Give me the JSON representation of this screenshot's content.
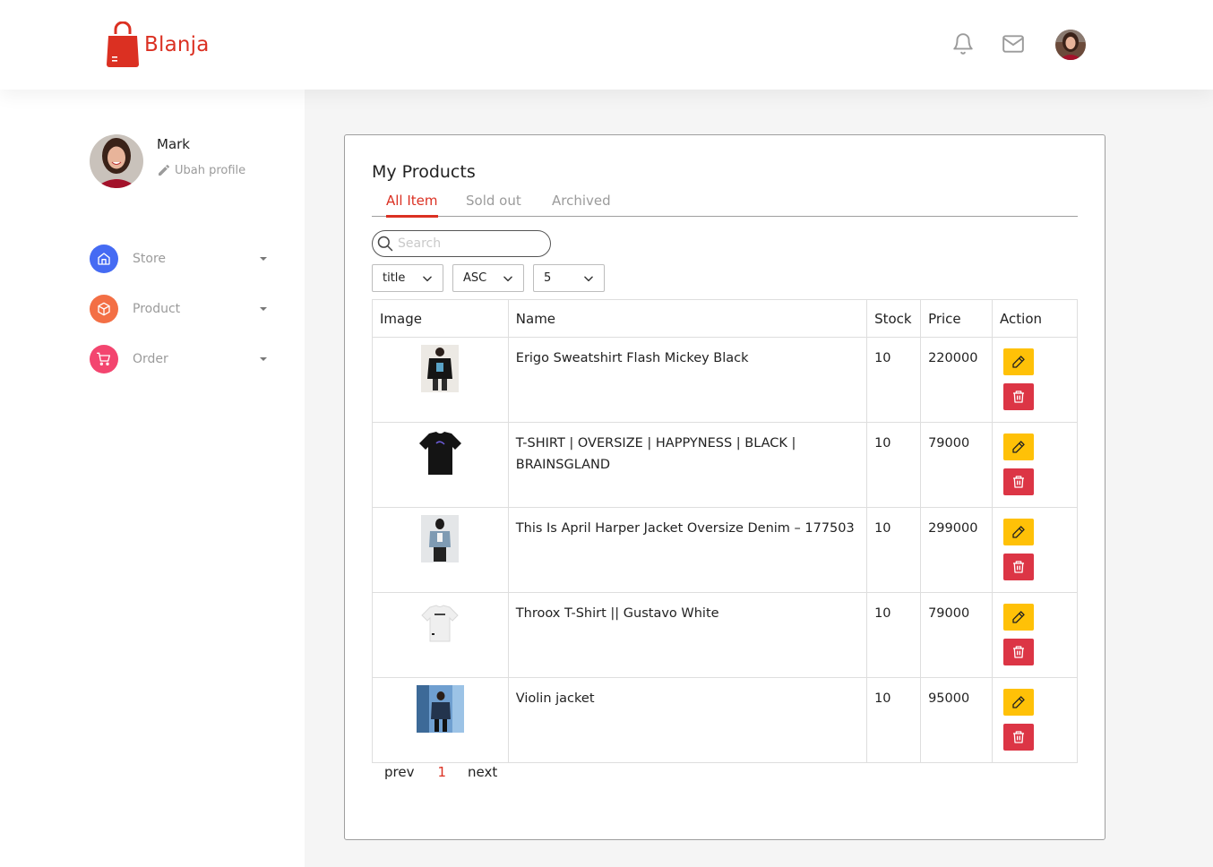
{
  "header": {
    "brand": "Blanja",
    "brand_color": "#db3022",
    "icons": [
      "bell-icon",
      "mail-icon"
    ]
  },
  "sidebar": {
    "profile_name": "Mark",
    "edit_label": "Ubah profile",
    "items": [
      {
        "label": "Store",
        "icon": "home-icon",
        "color": "#456bf3"
      },
      {
        "label": "Product",
        "icon": "package-icon",
        "color": "#f36f45"
      },
      {
        "label": "Order",
        "icon": "cart-icon",
        "color": "#f3456f"
      }
    ]
  },
  "main": {
    "title": "My Products",
    "tabs": [
      {
        "label": "All Item",
        "active": true
      },
      {
        "label": "Sold out",
        "active": false
      },
      {
        "label": "Archived",
        "active": false
      }
    ],
    "search": {
      "placeholder": "Search",
      "value": ""
    },
    "filters": {
      "sort_by": "title",
      "order": "ASC",
      "limit": "5"
    },
    "table": {
      "headers": [
        "Image",
        "Name",
        "Stock",
        "Price",
        "Action"
      ],
      "rows": [
        {
          "name": "Erigo Sweatshirt Flash Mickey Black",
          "stock": "10",
          "price": "220000"
        },
        {
          "name": "T-SHIRT | OVERSIZE | HAPPYNESS | BLACK | BRAINSGLAND",
          "stock": "10",
          "price": "79000"
        },
        {
          "name": "This Is April Harper Jacket Oversize Denim – 177503",
          "stock": "10",
          "price": "299000"
        },
        {
          "name": "Throox T-Shirt || Gustavo White",
          "stock": "10",
          "price": "79000"
        },
        {
          "name": "Violin jacket",
          "stock": "10",
          "price": "95000"
        }
      ]
    },
    "pagination": {
      "prev": "prev",
      "current": "1",
      "next": "next"
    }
  }
}
